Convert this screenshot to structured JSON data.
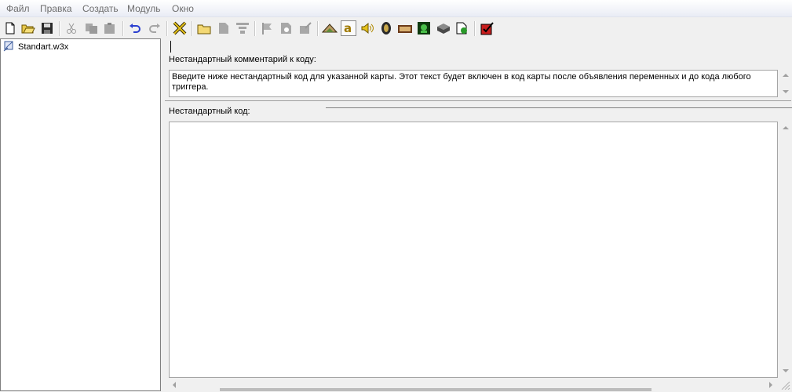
{
  "menu": [
    "Файл",
    "Правка",
    "Создать",
    "Модуль",
    "Окно"
  ],
  "tree": {
    "file": "Standart.w3x"
  },
  "comment": {
    "label": "Нестандартный комментарий к коду:",
    "text": "Введите ниже нестандартный код для указанной карты. Этот текст будет включен в код карты после объявления переменных и до кода любого триггера."
  },
  "code": {
    "label": "Нестандартный код:",
    "text": ""
  },
  "icons": [
    "new-icon",
    "open-icon",
    "save-icon",
    "cut-icon",
    "copy-icon",
    "paste-icon",
    "undo-icon",
    "redo-icon",
    "delete-icon",
    "folder-icon",
    "page-icon",
    "align-icon",
    "flag-icon",
    "doc-gear-icon",
    "doc-edit-icon",
    "terrain-icon",
    "trigger-icon",
    "sound-icon",
    "object-icon",
    "campaign-icon",
    "ai-icon",
    "import-icon",
    "test-map-icon",
    "check-icon"
  ]
}
